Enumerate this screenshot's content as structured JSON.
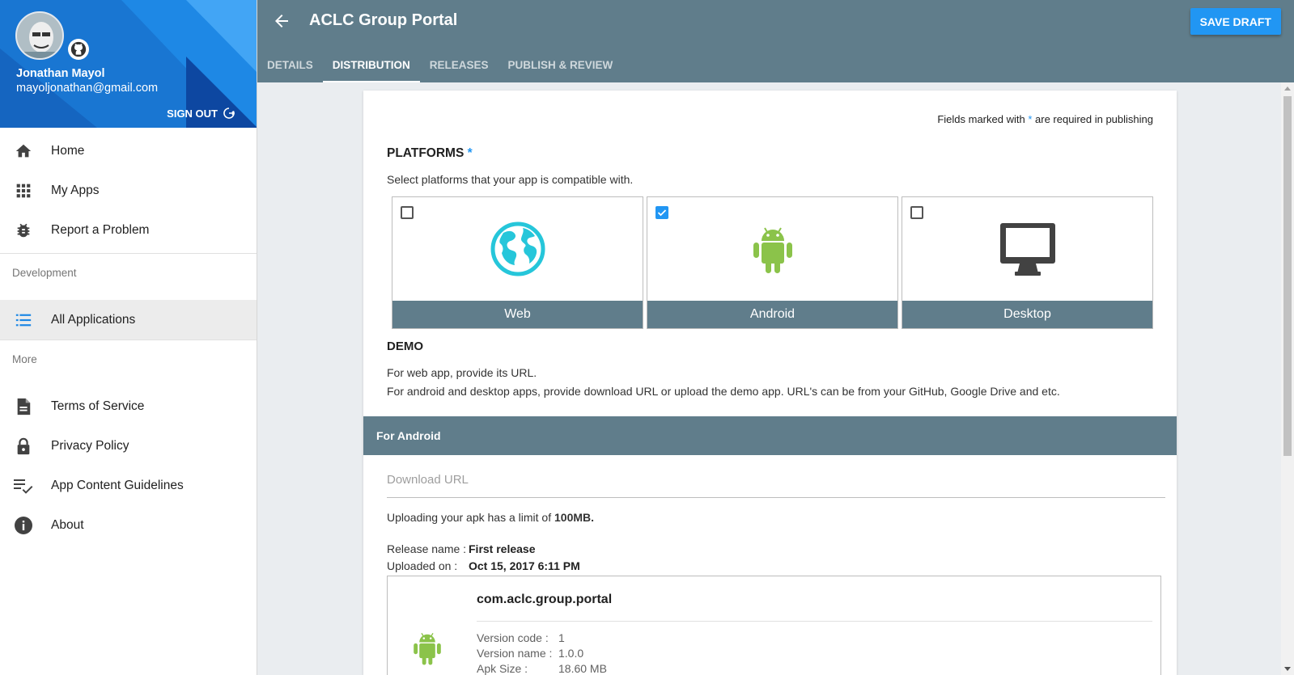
{
  "sidebar": {
    "user_name": "Jonathan Mayol",
    "user_email": "mayoljonathan@gmail.com",
    "signout_label": "SIGN OUT",
    "nav_main": [
      {
        "label": "Home",
        "icon": "home-icon"
      },
      {
        "label": "My Apps",
        "icon": "apps-grid-icon"
      },
      {
        "label": "Report a Problem",
        "icon": "bug-icon"
      }
    ],
    "section_development": "Development",
    "nav_dev": [
      {
        "label": "All Applications",
        "icon": "list-icon"
      }
    ],
    "section_more": "More",
    "nav_more": [
      {
        "label": "Terms of Service",
        "icon": "document-icon"
      },
      {
        "label": "Privacy Policy",
        "icon": "lock-icon"
      },
      {
        "label": "App Content Guidelines",
        "icon": "checklist-icon"
      },
      {
        "label": "About",
        "icon": "info-icon"
      }
    ]
  },
  "header": {
    "title": "ACLC Group Portal",
    "save_label": "SAVE DRAFT",
    "tabs": [
      {
        "label": "DETAILS",
        "active": false
      },
      {
        "label": "DISTRIBUTION",
        "active": true
      },
      {
        "label": "RELEASES",
        "active": false
      },
      {
        "label": "PUBLISH & REVIEW",
        "active": false
      }
    ]
  },
  "form": {
    "required_note_prefix": "Fields marked with",
    "required_star": "*",
    "required_note_suffix": "are required in publishing",
    "platforms_heading": "PLATFORMS",
    "platforms_desc": "Select platforms that your app is compatible with.",
    "platforms": [
      {
        "label": "Web",
        "checked": false,
        "icon": "globe-icon"
      },
      {
        "label": "Android",
        "checked": true,
        "icon": "android-icon"
      },
      {
        "label": "Desktop",
        "checked": false,
        "icon": "monitor-icon"
      }
    ],
    "demo_heading": "DEMO",
    "demo_line1": "For web app, provide its URL.",
    "demo_line2": "For android and desktop apps, provide download URL or upload the demo app. URL's can be from your GitHub, Google Drive and etc.",
    "android_section": "For Android",
    "download_placeholder": "Download URL",
    "upload_limit_text": "Uploading your apk has a limit of",
    "upload_limit_value": "100MB.",
    "release_name_label": "Release name :",
    "release_name_value": "First release",
    "uploaded_on_label": "Uploaded on :",
    "uploaded_on_value": "Oct 15, 2017 6:11 PM",
    "apk": {
      "package": "com.aclc.group.portal",
      "version_code_label": "Version code :",
      "version_code": "1",
      "version_name_label": "Version name :",
      "version_name": "1.0.0",
      "apk_size_label": "Apk Size :",
      "apk_size": "18.60 MB"
    }
  },
  "colors": {
    "header": "#607d8b",
    "accent": "#2196f3",
    "android_green": "#8bc34a",
    "globe_teal": "#26c6da"
  }
}
